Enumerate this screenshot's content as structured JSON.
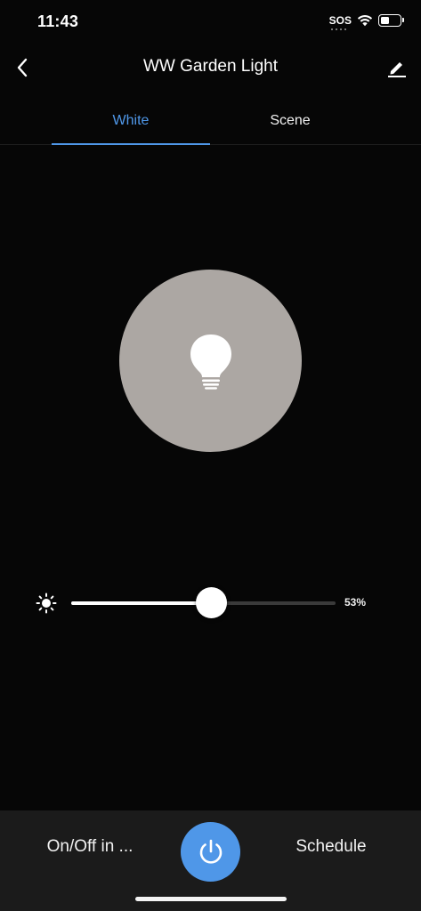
{
  "status_bar": {
    "time": "11:43",
    "sos_label": "SOS",
    "battery_level_fraction": 0.45
  },
  "header": {
    "title": "WW Garden Light",
    "back_icon": "chevron-left-icon",
    "edit_icon": "pencil-icon"
  },
  "tabs": [
    {
      "label": "White",
      "active": true
    },
    {
      "label": "Scene",
      "active": false
    }
  ],
  "light": {
    "bulb_icon": "lightbulb-icon",
    "circle_color": "#aca7a3"
  },
  "brightness": {
    "icon": "sun-icon",
    "value_percent": 53,
    "value_label": "53%"
  },
  "bottom_bar": {
    "left_label": "On/Off in ...",
    "right_label": "Schedule",
    "power_icon": "power-icon"
  },
  "colors": {
    "accent": "#4f97e8",
    "background": "#060606",
    "bottom_bar": "#1b1b1b"
  }
}
